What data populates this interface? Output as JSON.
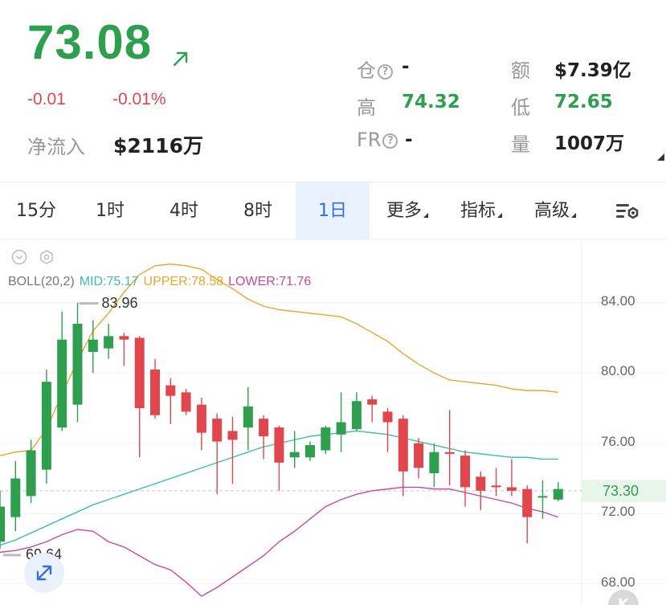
{
  "quote": {
    "price": "73.08",
    "change_abs": "-0.01",
    "change_pct": "-0.01%",
    "netflow_label": "净流入",
    "netflow_value": "$2116万"
  },
  "stats": {
    "cang_label": "仓",
    "cang_value": "-",
    "e_label": "额",
    "e_value": "$7.39亿",
    "high_label": "高",
    "high_value": "74.32",
    "low_label": "低",
    "low_value": "72.65",
    "fr_label": "FR",
    "fr_value": "-",
    "vol_label": "量",
    "vol_value": "1007万"
  },
  "tabs": [
    {
      "label": "15分",
      "active": false
    },
    {
      "label": "1时",
      "active": false
    },
    {
      "label": "4时",
      "active": false
    },
    {
      "label": "8时",
      "active": false
    },
    {
      "label": "1日",
      "active": true
    },
    {
      "label": "更多",
      "active": false,
      "dropdown": true
    },
    {
      "label": "指标",
      "active": false,
      "dropdown": true
    },
    {
      "label": "高级",
      "active": false,
      "dropdown": true
    }
  ],
  "indicator": {
    "name": "BOLL(20,2)",
    "mid": "MID:75.17",
    "upper": "UPPER:78.58",
    "lower": "LOWER:71.76"
  },
  "colors": {
    "up": "#2e9e4f",
    "down": "#e0474c",
    "mid": "#3dbfa8",
    "upper": "#e6a82b",
    "lower": "#c94a9a",
    "active_tab": "#2f6fe0"
  },
  "icons": {
    "arrow": "arrow-up-right-icon",
    "settings": "chart-settings-icon",
    "collapse": "chevron-down-circle-icon",
    "hex": "hexagon-settings-icon",
    "expand": "expand-diagonal-icon"
  },
  "k_button": "K",
  "chart_data": {
    "type": "candlestick",
    "y_ticks": [
      "84.00",
      "80.00",
      "76.00",
      "72.00",
      "68.00"
    ],
    "ylim": [
      66.8,
      87.6
    ],
    "last_price": "73.30",
    "high_marker": "83.96",
    "low_marker": "69.64",
    "candles": [
      {
        "o": 70.4,
        "c": 72.4,
        "h": 73.3,
        "l": 70.0
      },
      {
        "o": 71.8,
        "c": 74.0,
        "h": 75.0,
        "l": 71.0
      },
      {
        "o": 73.0,
        "c": 75.6,
        "h": 76.2,
        "l": 72.6
      },
      {
        "o": 74.5,
        "c": 79.5,
        "h": 80.2,
        "l": 73.7
      },
      {
        "o": 76.9,
        "c": 81.9,
        "h": 83.5,
        "l": 76.7
      },
      {
        "o": 78.2,
        "c": 82.8,
        "h": 84.0,
        "l": 77.2
      },
      {
        "o": 81.2,
        "c": 81.9,
        "h": 83.0,
        "l": 80.0
      },
      {
        "o": 81.4,
        "c": 82.1,
        "h": 82.8,
        "l": 80.8
      },
      {
        "o": 82.1,
        "c": 81.9,
        "h": 82.3,
        "l": 80.4
      },
      {
        "o": 82.0,
        "c": 78.0,
        "h": 82.1,
        "l": 75.2
      },
      {
        "o": 80.2,
        "c": 77.6,
        "h": 80.8,
        "l": 77.4
      },
      {
        "o": 79.3,
        "c": 78.7,
        "h": 79.7,
        "l": 77.1
      },
      {
        "o": 78.9,
        "c": 77.8,
        "h": 79.1,
        "l": 77.6
      },
      {
        "o": 78.2,
        "c": 76.6,
        "h": 78.6,
        "l": 75.6
      },
      {
        "o": 77.4,
        "c": 76.1,
        "h": 77.7,
        "l": 73.1
      },
      {
        "o": 76.7,
        "c": 76.2,
        "h": 77.5,
        "l": 73.7
      },
      {
        "o": 76.9,
        "c": 78.1,
        "h": 79.2,
        "l": 75.6
      },
      {
        "o": 77.4,
        "c": 76.4,
        "h": 77.6,
        "l": 75.1
      },
      {
        "o": 76.9,
        "c": 74.9,
        "h": 77.0,
        "l": 73.3
      },
      {
        "o": 75.2,
        "c": 75.5,
        "h": 76.7,
        "l": 74.6
      },
      {
        "o": 75.2,
        "c": 75.9,
        "h": 76.1,
        "l": 75.0
      },
      {
        "o": 75.6,
        "c": 76.9,
        "h": 77.0,
        "l": 75.4
      },
      {
        "o": 76.5,
        "c": 77.2,
        "h": 78.9,
        "l": 75.5
      },
      {
        "o": 76.8,
        "c": 78.4,
        "h": 78.9,
        "l": 76.7
      },
      {
        "o": 78.5,
        "c": 78.2,
        "h": 78.7,
        "l": 77.2
      },
      {
        "o": 77.8,
        "c": 77.2,
        "h": 78.0,
        "l": 75.5
      },
      {
        "o": 77.4,
        "c": 74.4,
        "h": 77.6,
        "l": 73.0
      },
      {
        "o": 76.0,
        "c": 74.6,
        "h": 76.3,
        "l": 74.0
      },
      {
        "o": 74.3,
        "c": 75.5,
        "h": 76.0,
        "l": 73.5
      },
      {
        "o": 75.5,
        "c": 75.4,
        "h": 77.9,
        "l": 73.6
      },
      {
        "o": 75.3,
        "c": 73.5,
        "h": 75.6,
        "l": 72.4
      },
      {
        "o": 74.1,
        "c": 73.3,
        "h": 74.4,
        "l": 72.2
      },
      {
        "o": 73.6,
        "c": 73.5,
        "h": 74.6,
        "l": 73.0
      },
      {
        "o": 73.5,
        "c": 73.3,
        "h": 75.1,
        "l": 73.0
      },
      {
        "o": 73.4,
        "c": 71.8,
        "h": 73.6,
        "l": 70.3
      },
      {
        "o": 73.0,
        "c": 73.0,
        "h": 73.9,
        "l": 71.7
      },
      {
        "o": 72.8,
        "c": 73.4,
        "h": 73.8,
        "l": 72.7
      }
    ],
    "mid": [
      70.2,
      70.5,
      70.9,
      71.3,
      71.7,
      72.1,
      72.5,
      72.8,
      73.1,
      73.4,
      73.7,
      74.0,
      74.3,
      74.6,
      74.9,
      75.2,
      75.5,
      75.8,
      76.0,
      76.2,
      76.4,
      76.5,
      76.6,
      76.7,
      76.6,
      76.5,
      76.3,
      76.1,
      75.9,
      75.7,
      75.5,
      75.4,
      75.3,
      75.2,
      75.2,
      75.1,
      75.1
    ],
    "upper": [
      75.3,
      75.5,
      75.6,
      76.8,
      78.8,
      80.7,
      82.4,
      83.4,
      84.6,
      85.6,
      86.1,
      86.2,
      86.1,
      85.9,
      85.3,
      84.8,
      84.2,
      83.8,
      83.6,
      83.5,
      83.4,
      83.3,
      83.2,
      82.8,
      82.3,
      81.8,
      81.1,
      80.5,
      80.0,
      79.6,
      79.5,
      79.4,
      79.3,
      79.1,
      79.0,
      79.0,
      78.9
    ],
    "lower": [
      69.8,
      69.9,
      70.1,
      70.4,
      70.8,
      71.1,
      71.0,
      70.4,
      70.1,
      69.6,
      69.1,
      68.8,
      68.1,
      67.3,
      67.8,
      68.4,
      69.0,
      69.6,
      70.4,
      71.0,
      71.7,
      72.4,
      72.8,
      73.1,
      73.3,
      73.4,
      73.5,
      73.5,
      73.4,
      73.4,
      73.2,
      73.0,
      72.8,
      72.6,
      72.3,
      72.1,
      71.8
    ]
  }
}
